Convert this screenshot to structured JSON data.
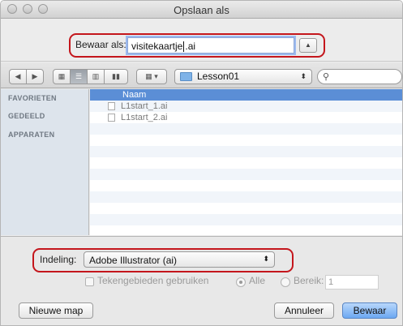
{
  "window": {
    "title": "Opslaan als"
  },
  "saveas": {
    "label": "Bewaar als:",
    "filename_before_caret": "visitekaartje",
    "filename_after_caret": ".ai"
  },
  "toolbar": {
    "location": "Lesson01"
  },
  "sidebar": {
    "sections": [
      "FAVORIETEN",
      "GEDEELD",
      "APPARATEN"
    ]
  },
  "filelist": {
    "column_header": "Naam",
    "files": [
      {
        "name": "L1start_1.ai"
      },
      {
        "name": "L1start_2.ai"
      }
    ]
  },
  "format": {
    "label": "Indeling:",
    "selected": "Adobe Illustrator (ai)",
    "use_artboards_label": "Tekengebieden gebruiken",
    "all_label": "Alle",
    "range_label": "Bereik:",
    "range_value": "1"
  },
  "buttons": {
    "new_folder": "Nieuwe map",
    "cancel": "Annuleer",
    "save": "Bewaar"
  },
  "colors": {
    "highlight_ring": "#c4161c",
    "selection": "#5b8ed6",
    "default_button": "#6ca8f2"
  }
}
